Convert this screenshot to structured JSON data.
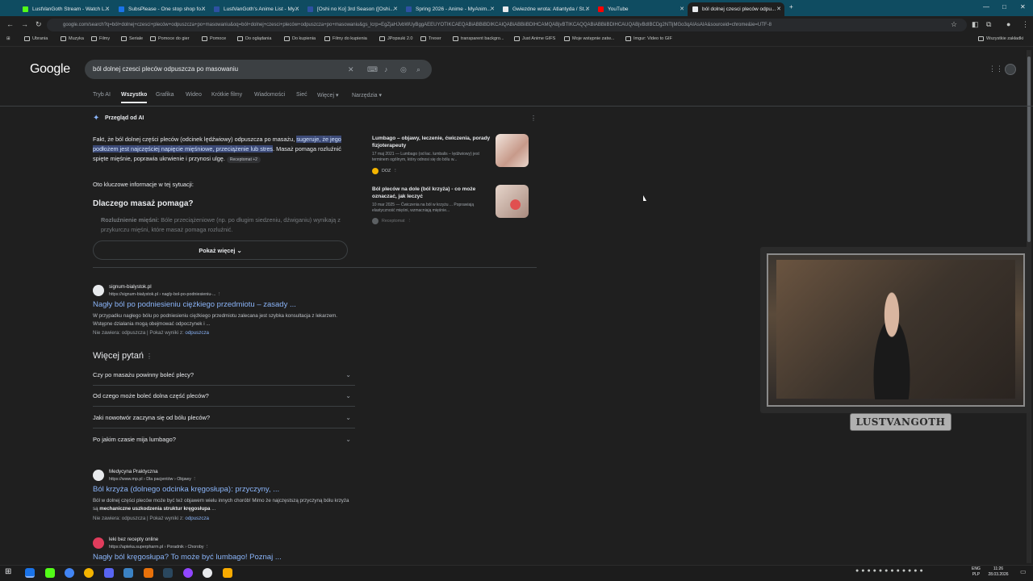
{
  "tabs": [
    {
      "label": "LustVanGoth Stream - Watch L...",
      "color": "#53fc18"
    },
    {
      "label": "SubsPlease - One stop shop fo...",
      "color": "#1a73e8"
    },
    {
      "label": "LustVanGoth's Anime List - My...",
      "color": "#2e51a2"
    },
    {
      "label": "[Oshi no Ko] 3rd Season ([Oshi...",
      "color": "#2e51a2"
    },
    {
      "label": "Spring 2026 - Anime - MyAnim...",
      "color": "#2e51a2"
    },
    {
      "label": "Gwiezdne wrota: Atlantyda / St...",
      "color": "#e8eaed"
    },
    {
      "label": "YouTube",
      "color": "#ff0000"
    },
    {
      "label": "ból dolnej czesci pleców odpu...",
      "color": "#e8eaed"
    }
  ],
  "address": "google.com/search?q=ból+dolnej+czesci+pleców+odpuszcza+po+masowaniu&oq=ból+dolnej+czesci+pleców+odpuszcza+po+masowaniu&gs_lcrp=EgZjaHJvbWUyBggAEEUYOTIKCAEQABiABBiBDIKCAIQABiABBiiBDIHCAMQABjvBTIKCAQQABiABBiiBDIHCAUQABjvBdIBCDg2NTljMGo3qAIAsAIA&sourceid=chrome&ie=UTF-8",
  "bookmarks": [
    "Ubrania",
    "Muzyka",
    "Filmy",
    "Seriale",
    "Pomoce do gier",
    "Pomoce",
    "Do oglądania",
    "Do kupienia",
    "Filmy do kupienia",
    "JPopsuki 2.0",
    "Trexer",
    "transparent backgro...",
    "Just Anime GIFS",
    "Moje wstępnie zatw...",
    "Imgur: Video to GIF"
  ],
  "bookmarks_all": "Wszystkie zakładki",
  "search": {
    "logo": "Google",
    "query": "ból dolnej czesci pleców odpuszcza po masowaniu"
  },
  "nav_tabs": [
    "Tryb AI",
    "Wszystko",
    "Grafika",
    "Wideo",
    "Krótkie filmy",
    "Wiadomości",
    "Sieć",
    "Więcej",
    "Narzędzia"
  ],
  "ai": {
    "title": "Przegląd od AI",
    "p1_a": "Fakt, że ból dolnej części pleców (odcinek lędźwiowy) odpuszcza po masażu, ",
    "p1_hl": "sugeruje, że jego podłożem jest najczęściej napięcie mięśniowe, przeciążenie lub stres",
    "p1_b": ". Masaż pomaga rozluźnić spięte mięśnie, poprawia ukrwienie i przynosi ulgę.",
    "p1_chip": "Receptomat +2",
    "p2": "Oto kluczowe informacje w tej sytuacji:",
    "heading": "Dlaczego masaż pomaga?",
    "faded_label": "Rozluźnienie mięśni:",
    "faded_text": " Bóle przeciążeniowe (np. po długim siedzeniu, dźwiganiu) wynikają z przykurczu mięśni, które masaż pomaga rozluźnić.",
    "show_more": "Pokaż więcej",
    "cards": [
      {
        "title": "Lumbago – objawy, leczenie, ćwiczenia, porady fizjoterapeuty",
        "meta": "17 maj 2021 — Lumbago (od łac. lumbalis – lędźwiowy) jest terminem ogólnym, który odnosi się do bólu w...",
        "src": "DOZ"
      },
      {
        "title": "Ból pleców na dole (ból krzyża) - co może oznaczać, jak leczyć",
        "meta": "10 mar 2025 — Ćwiczenia na ból w krzyżu ... Poprawiają elastyczność mięśni, wzmacniają mięśnie...",
        "src": "Receptomat"
      }
    ]
  },
  "results": [
    {
      "site": "signum-bialystok.pl",
      "url": "https://signum-bialystok.pl › nagly-bol-po-podniesieniu-...",
      "title": "Nagły ból po podniesieniu ciężkiego przedmiotu – zasady ...",
      "snippet": "W przypadku nagłego bólu po podniesieniu ciężkiego przedmiotu zalecana jest szybka konsultacja z lekarzem. Wstępne działania mogą obejmować odpoczynek i ...",
      "missing": "Nie zawiera: odpuszcza | Pokaż wyniki z: ",
      "missing_link": "odpuszcza"
    },
    {
      "site": "Medycyna Praktyczna",
      "url": "https://www.mp.pl › Dla pacjentów › Objawy",
      "title": "Ból krzyża (dolnego odcinka kręgosłupa): przyczyny, ...",
      "snippet_a": "Ból w dolnej części pleców może być też objawem wielu innych chorób! Mimo że najczęstszą przyczyną bólu krzyża są ",
      "snippet_b": "mechaniczne uszkodzenia struktur kręgosłupa",
      "snippet_c": " ...",
      "missing": "Nie zawiera: odpuszcza | Pokaż wyniki z: ",
      "missing_link": "odpuszcza"
    },
    {
      "site": "leki bez recepty online",
      "url": "https://apteka.superpharm.pl › Poradnik › Choroby",
      "title": "Nagły ból kręgosłupa? To może być lumbago! Poznaj ..."
    }
  ],
  "paa": {
    "heading": "Więcej pytań",
    "items": [
      "Czy po masażu powinny boleć plecy?",
      "Od czego może boleć dolna część pleców?",
      "Jaki nowotwór zaczyna się od bólu pleców?",
      "Po jakim czasie mija lumbago?"
    ]
  },
  "webcam": {
    "name": "LUSTVANGOTH"
  },
  "tray": {
    "lang": "ENG\nPLP",
    "time": "11:26",
    "date": "28.03.2026"
  }
}
